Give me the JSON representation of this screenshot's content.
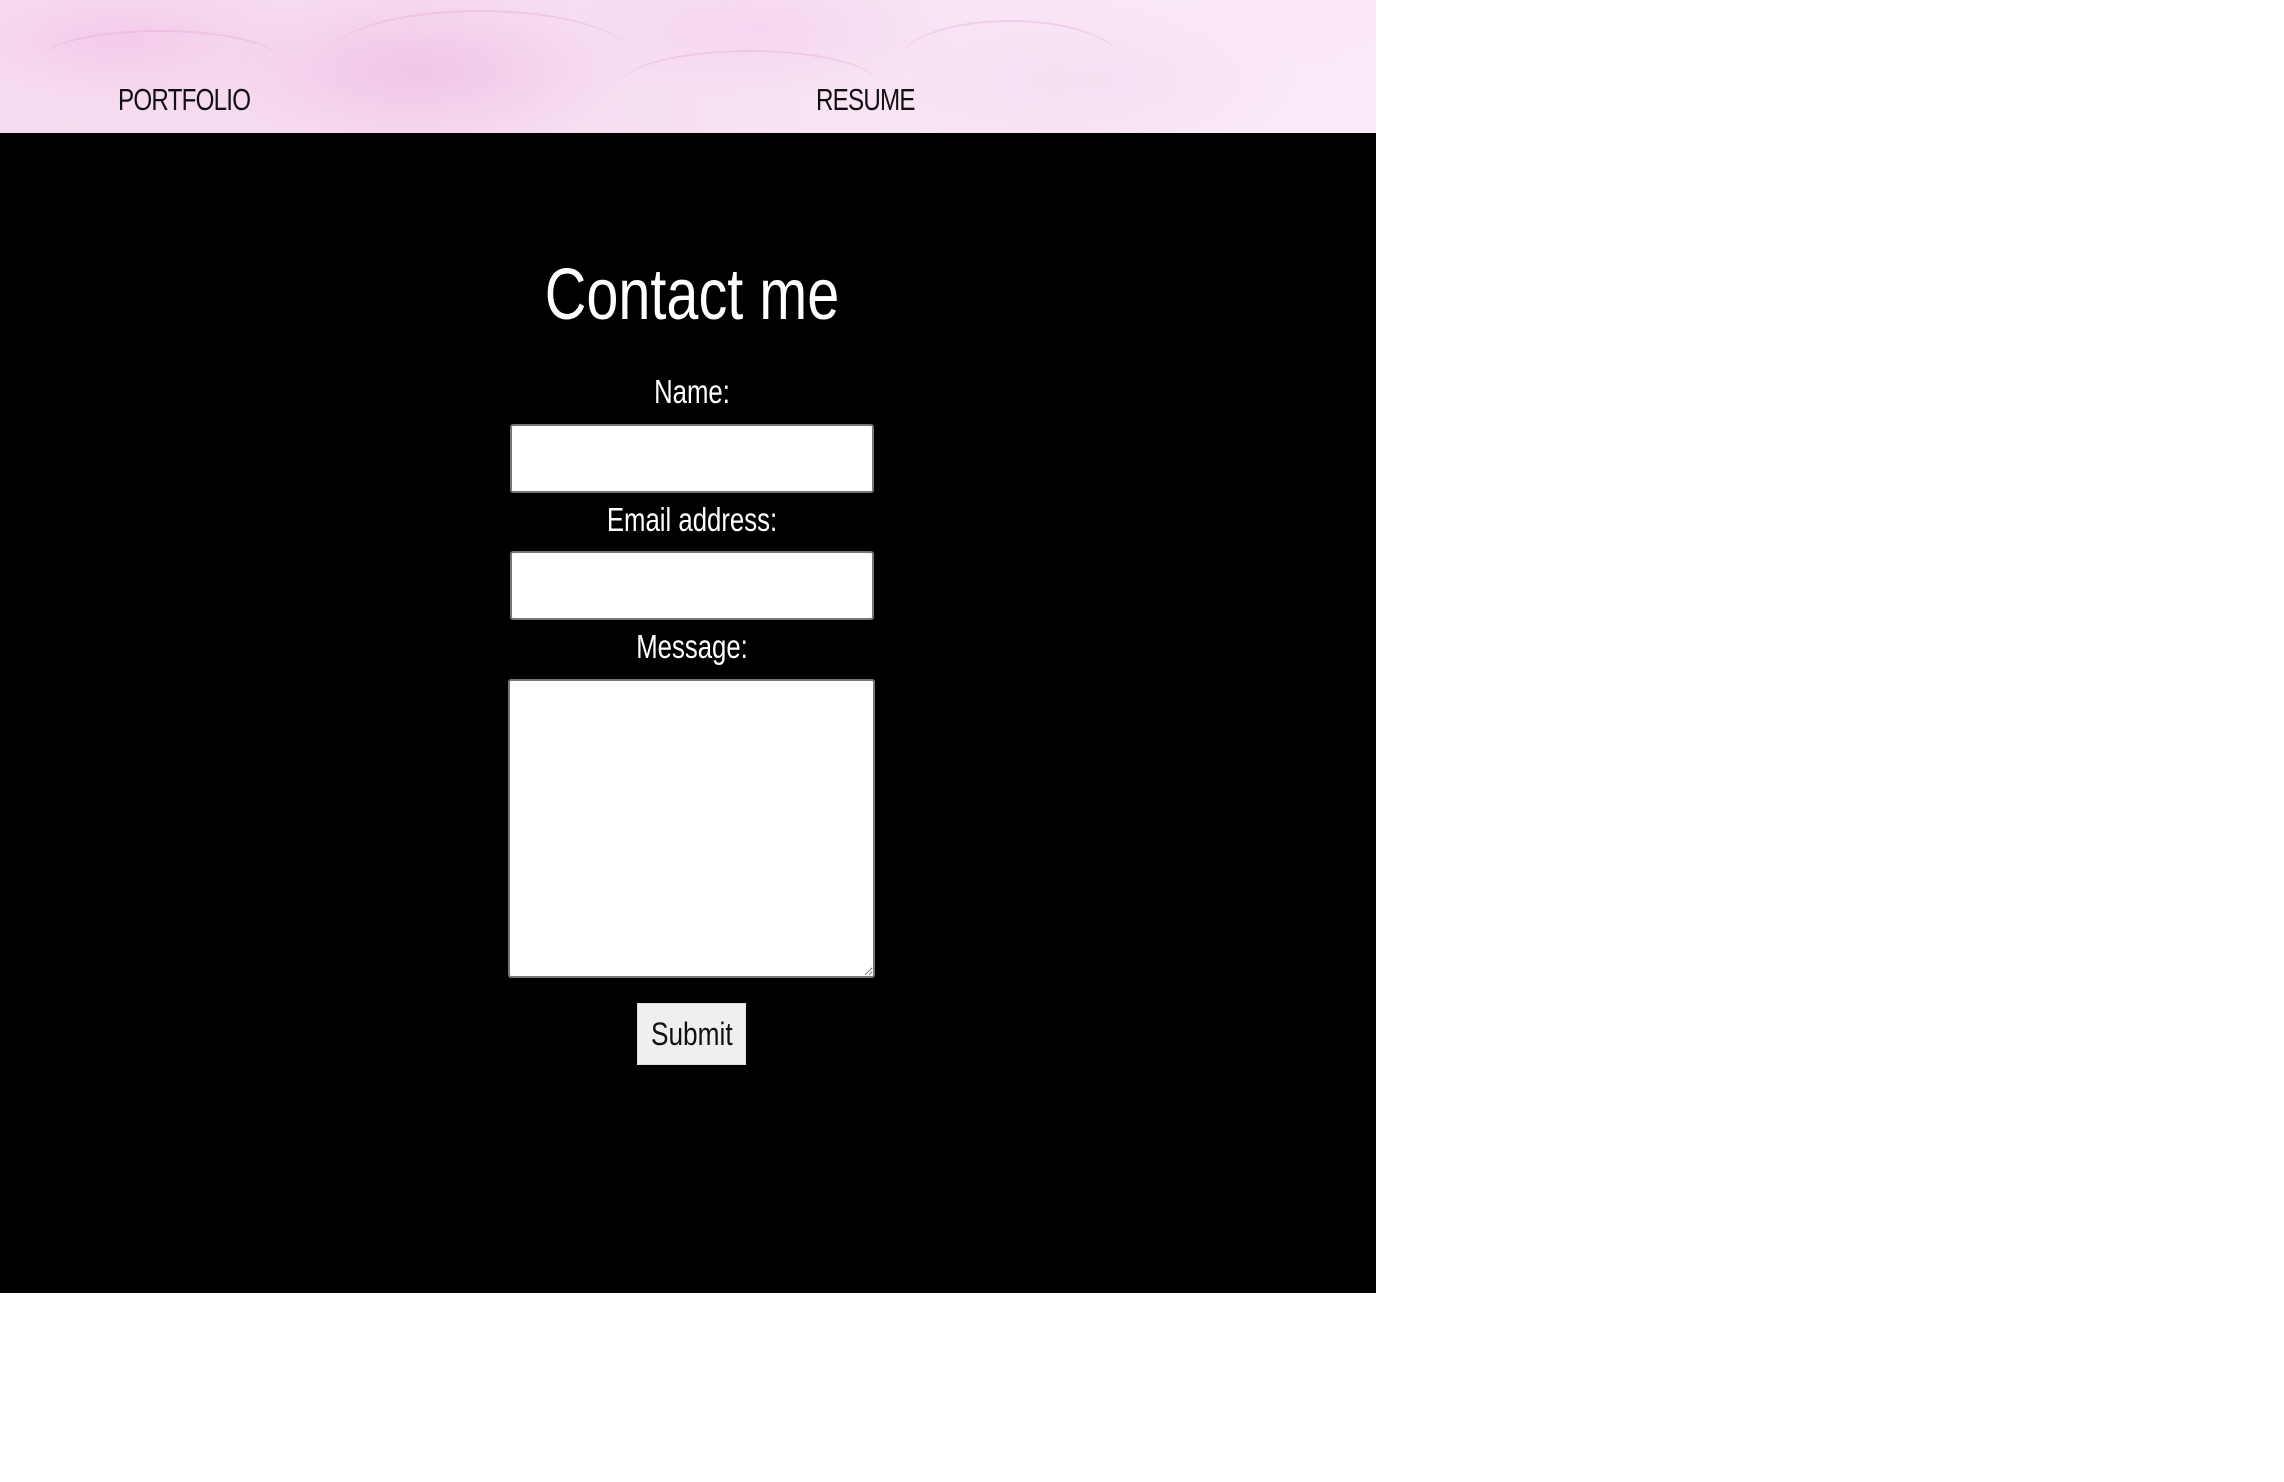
{
  "nav": {
    "items": [
      {
        "label": "PORTFOLIO"
      },
      {
        "label": "RESUME"
      }
    ]
  },
  "contact": {
    "title": "Contact me",
    "fields": {
      "name": {
        "label": "Name:",
        "value": "",
        "placeholder": ""
      },
      "email": {
        "label": "Email address:",
        "value": "",
        "placeholder": ""
      },
      "message": {
        "label": "Message:",
        "value": "",
        "placeholder": ""
      }
    },
    "submit_label": "Submit"
  },
  "colors": {
    "header_bg": "#f7dcf1",
    "section_bg": "#000000",
    "text_light": "#ffffff",
    "text_dark": "#111111",
    "button_bg": "#efefef"
  }
}
